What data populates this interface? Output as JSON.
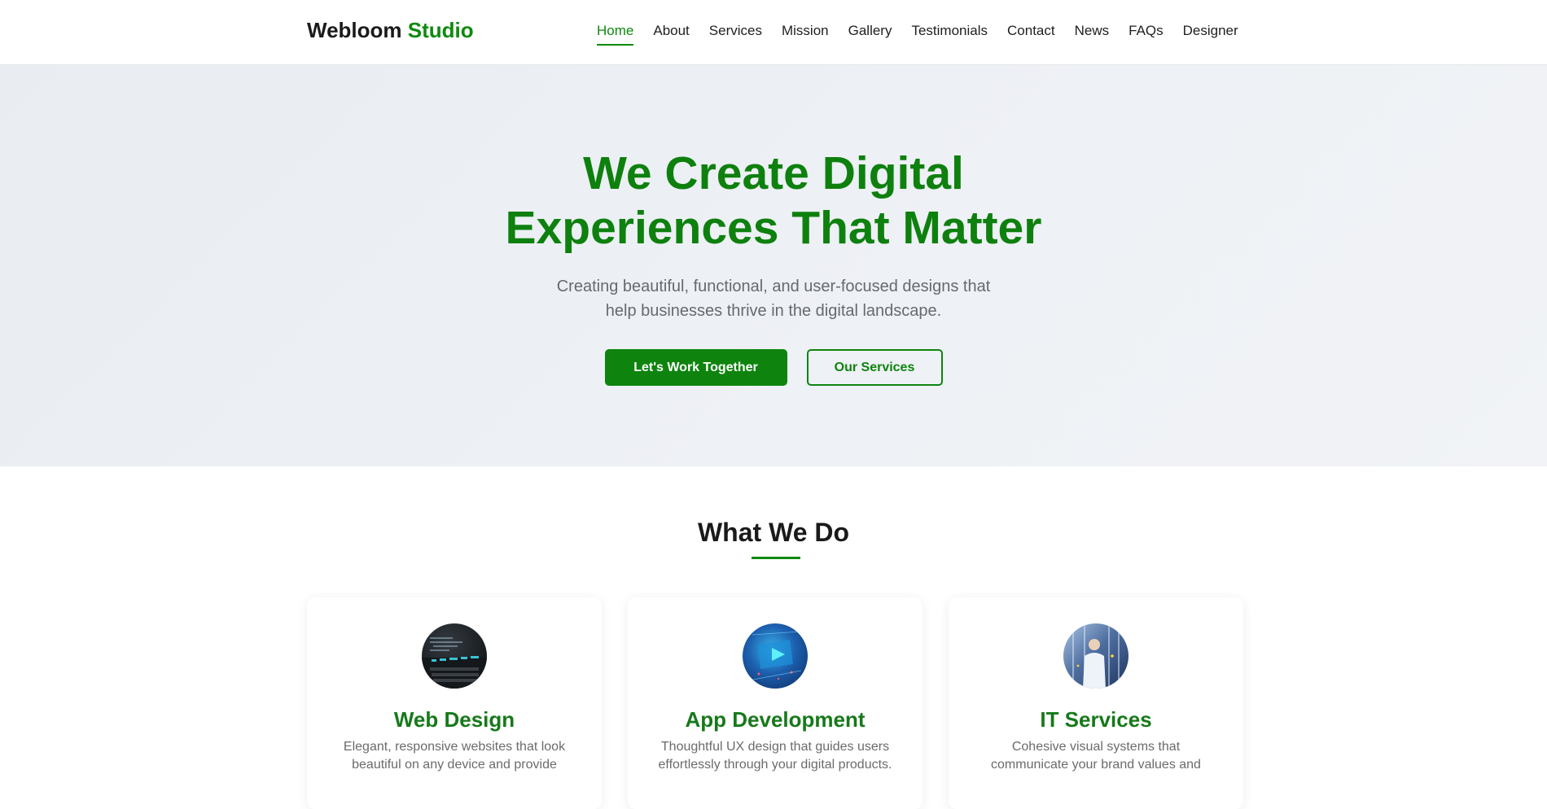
{
  "header": {
    "logo_main": "Webloom",
    "logo_accent": "Studio",
    "nav": [
      {
        "label": "Home",
        "active": true
      },
      {
        "label": "About"
      },
      {
        "label": "Services"
      },
      {
        "label": "Mission"
      },
      {
        "label": "Gallery"
      },
      {
        "label": "Testimonials"
      },
      {
        "label": "Contact"
      },
      {
        "label": "News"
      },
      {
        "label": "FAQs"
      },
      {
        "label": "Designer"
      }
    ]
  },
  "hero": {
    "title_line1": "We Create Digital",
    "title_line2": "Experiences That Matter",
    "subtitle_line1": "Creating beautiful, functional, and user-focused designs that",
    "subtitle_line2": "help businesses thrive in the digital landscape.",
    "primary_button": "Let's Work Together",
    "secondary_button": "Our Services"
  },
  "services": {
    "title": "What We Do",
    "cards": [
      {
        "title": "Web Design",
        "line1": "Elegant, responsive websites that look",
        "line2": "beautiful on any device and provide"
      },
      {
        "title": "App Development",
        "line1": "Thoughtful UX design that guides users",
        "line2": "effortlessly through your digital products."
      },
      {
        "title": "IT Services",
        "line1": "Cohesive visual systems that",
        "line2": "communicate your brand values and"
      }
    ]
  },
  "colors": {
    "brand": "#0e8a0e",
    "hero_bg": "#eef1f5"
  }
}
